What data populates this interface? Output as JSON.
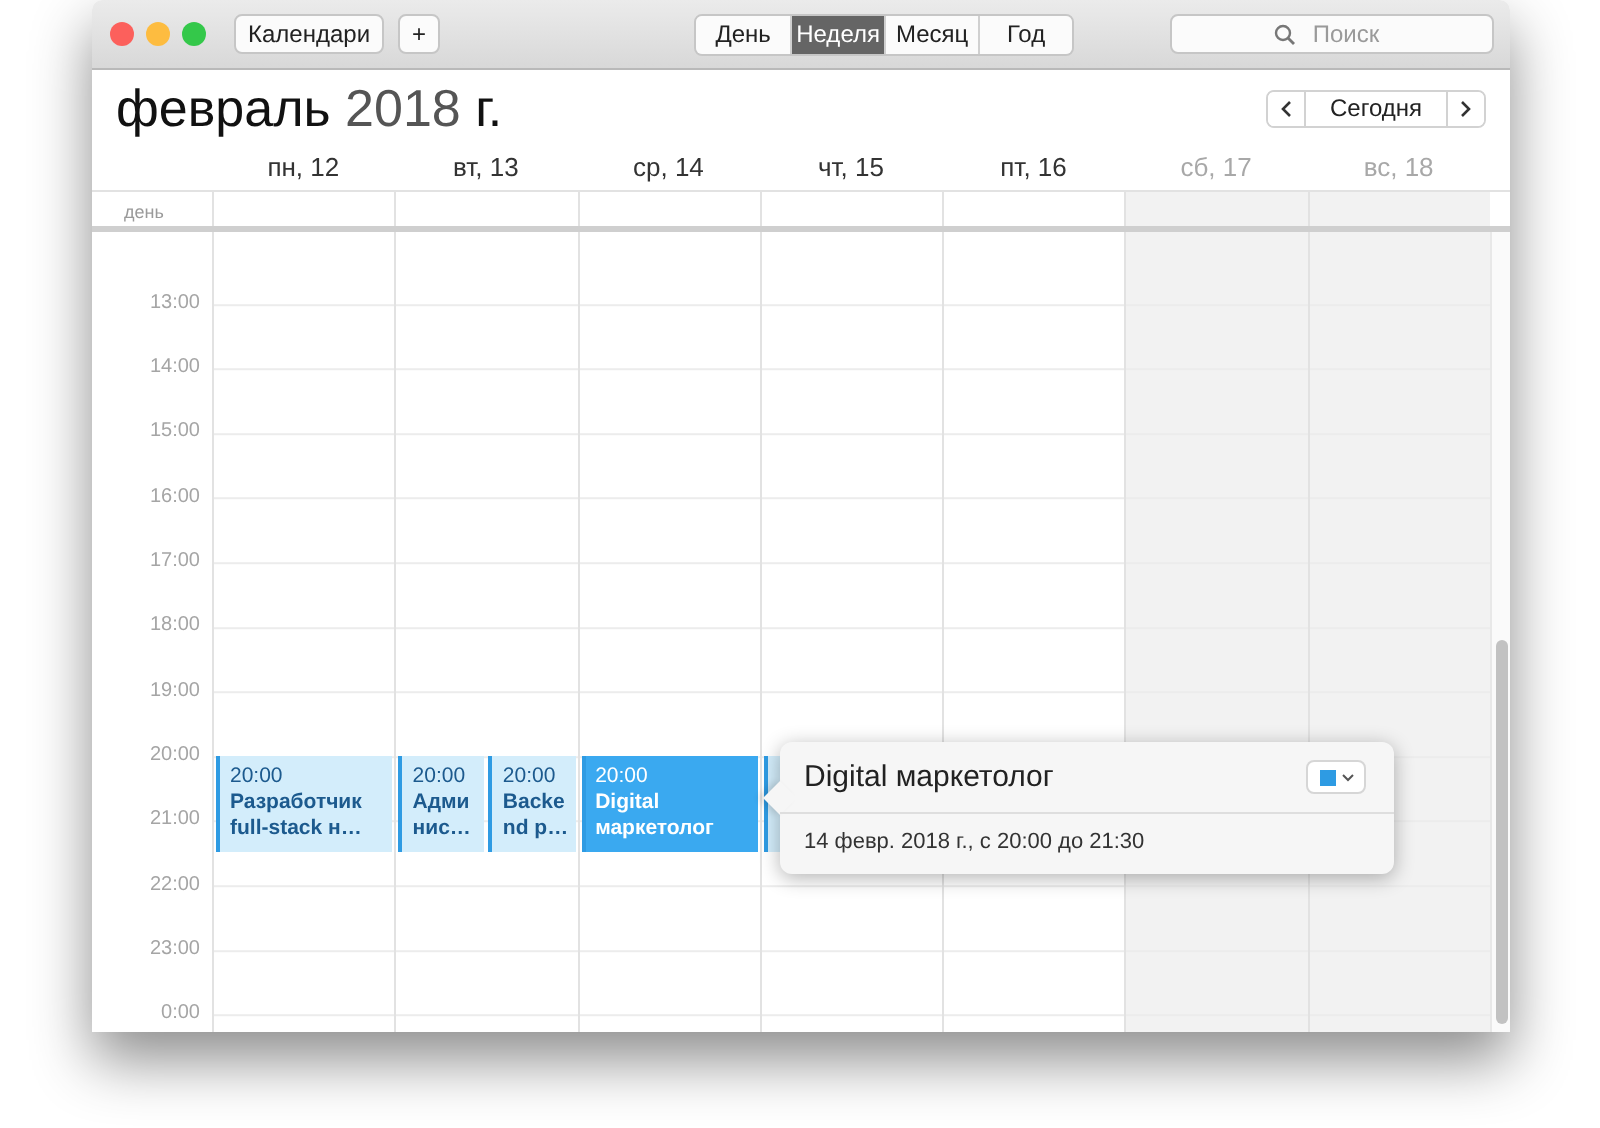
{
  "toolbar": {
    "calendars_button": "Календари",
    "add_button": "+",
    "views": [
      {
        "label": "День",
        "selected": false
      },
      {
        "label": "Неделя",
        "selected": true
      },
      {
        "label": "Месяц",
        "selected": false
      },
      {
        "label": "Год",
        "selected": false
      }
    ],
    "search": {
      "placeholder": "Поиск"
    }
  },
  "header": {
    "month": "февраль",
    "year": "2018",
    "suffix": "г.",
    "today_button": "Сегодня"
  },
  "all_day_label": "день",
  "hours": [
    "13:00",
    "14:00",
    "15:00",
    "16:00",
    "17:00",
    "18:00",
    "19:00",
    "20:00",
    "21:00",
    "22:00",
    "23:00",
    "0:00"
  ],
  "days": [
    {
      "label": "пн, 12",
      "weekend": false,
      "events": [
        {
          "time": "20:00",
          "title": "Разработчик full-stack н…",
          "selected": false
        }
      ]
    },
    {
      "label": "вт, 13",
      "weekend": false,
      "events": [
        {
          "time": "20:00",
          "title": "Админис…",
          "selected": false
        },
        {
          "time": "20:00",
          "title": "Backend p…",
          "selected": false
        }
      ]
    },
    {
      "label": "ср, 14",
      "weekend": false,
      "events": [
        {
          "time": "20:00",
          "title": "Digital маркетолог",
          "selected": true
        }
      ]
    },
    {
      "label": "чт, 15",
      "weekend": false,
      "events": [
        {
          "selected": false
        }
      ]
    },
    {
      "label": "пт, 16",
      "weekend": false
    },
    {
      "label": "сб, 17",
      "weekend": true
    },
    {
      "label": "вс, 18",
      "weekend": true
    }
  ],
  "popover": {
    "title": "Digital маркетолог",
    "details": "14 февр. 2018 г., с 20:00 до 21:30"
  }
}
